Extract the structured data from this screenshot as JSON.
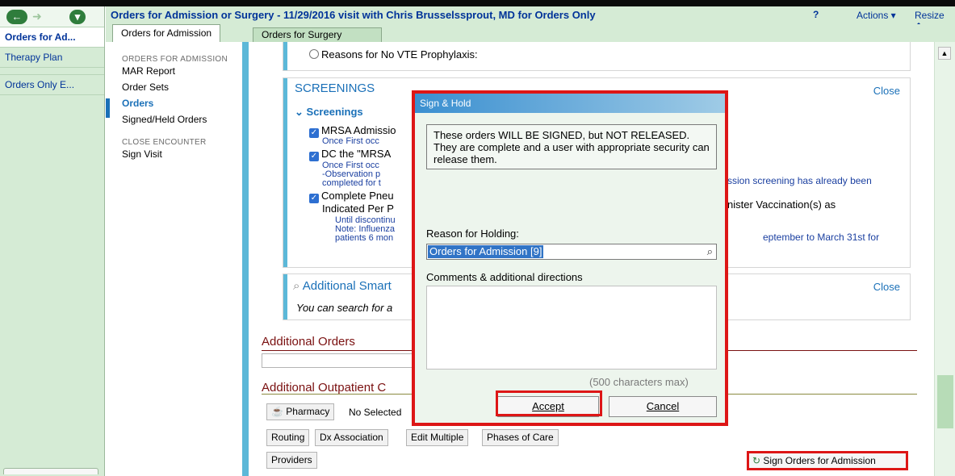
{
  "nav": {
    "items": [
      "Orders for Ad...",
      "Therapy Plan",
      "Orders Only E..."
    ]
  },
  "titlebar": {
    "title": "Orders for Admission or Surgery - 11/29/2016 visit with Chris Brusselssprout, MD for Orders Only",
    "help": "?",
    "actions": "Actions ▾",
    "resize": "Resize ⬍"
  },
  "tabs": [
    "Orders for Admission",
    "Orders for Surgery"
  ],
  "activity": {
    "section1": "ORDERS FOR ADMISSION",
    "links1": [
      "MAR Report",
      "Order Sets",
      "Orders",
      "Signed/Held Orders"
    ],
    "section2": "CLOSE ENCOUNTER",
    "links2": [
      "Sign Visit"
    ]
  },
  "content": {
    "vte_option": "Reasons for No VTE Prophylaxis:",
    "screenings_title": "SCREENINGS",
    "close": "Close",
    "screenings_sub": "Screenings",
    "item1_name": "MRSA Admissio",
    "item1_freq": "Once First occ",
    "item2_name": "DC the \"MRSA",
    "item2_freq": "Once First occ",
    "item2_note1": "-Observation p",
    "item2_note1_right": "ssion screening has already been",
    "item2_note2": "completed for t",
    "item3_name_a": "Complete Pneu",
    "item3_name_right": "nister Vaccination(s) as",
    "item3_name_b": "Indicated Per P",
    "item3_line1": "Until discontinu",
    "item3_line2": "Note: Influenza",
    "item3_line2_right": "eptember to March 31st for",
    "item3_line3": "patients 6 mon",
    "smart_title": "Additional Smart",
    "smart_hint": "You can search for a",
    "additional_orders": "Additional Orders",
    "additional_outpatient": "Additional Outpatient C",
    "pharmacy_label": "Pharmacy",
    "no_selected": "No Selected",
    "buttons": [
      "Routing",
      "Dx Association",
      "Edit Multiple",
      "Phases of Care"
    ],
    "providers": "Providers",
    "sign_orders": "Sign Orders for Admission"
  },
  "dialog": {
    "title": "Sign & Hold",
    "message": "These orders WILL BE SIGNED, but NOT RELEASED.  They are complete and a user with appropriate security can release them.",
    "reason_label": "Reason for Holding:",
    "reason_value": "Orders for Admission [9]",
    "comments_label": "Comments & additional directions",
    "comments_value": "",
    "max_chars": "(500 characters max)",
    "accept": "Accept",
    "cancel": "Cancel"
  },
  "colors": {
    "nav_green": "#d5ebd5",
    "link_blue": "#1a70b8",
    "accent_cyan": "#5cb8d8",
    "highlight_red": "#dd1616",
    "header_maroon": "#7a1010"
  }
}
